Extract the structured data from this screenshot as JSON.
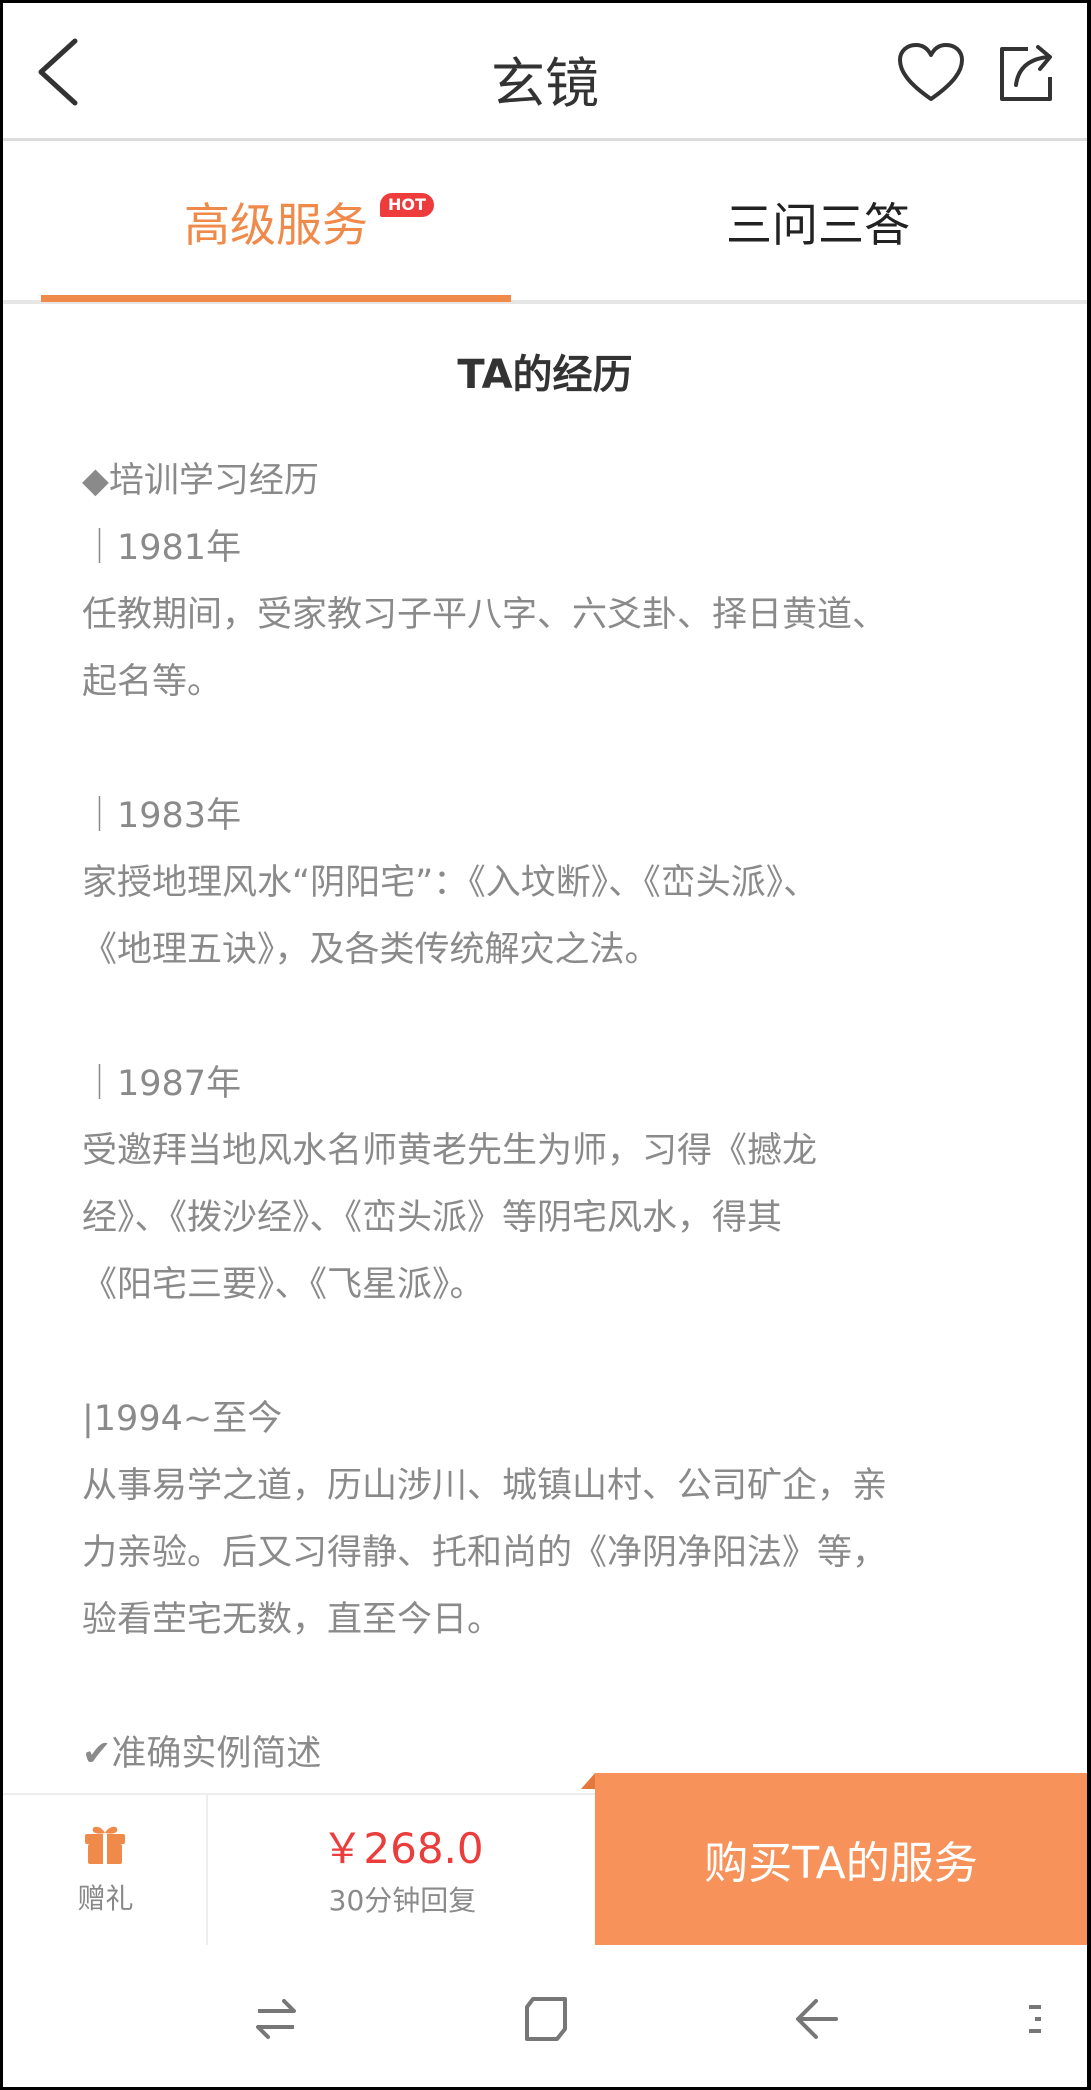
{
  "header": {
    "title": "玄镜"
  },
  "tabs": {
    "advanced_label": "高级服务",
    "hot_badge": "HOT",
    "qa_label": "三问三答"
  },
  "content": {
    "section_title": "TA的经历",
    "lines": [
      "◆培训学习经历",
      "｜1981年",
      "任教期间，受家教习子平八字、六爻卦、择日黄道、",
      "起名等。",
      "",
      "｜1983年",
      "家授地理风水“阴阳宅”：《入坟断》、《峦头派》、",
      "《地理五诀》，及各类传统解灾之法。",
      "",
      "｜1987年",
      "受邀拜当地风水名师黄老先生为师，习得《撼龙",
      "经》、《拨沙经》、《峦头派》等阴宅风水，得其",
      "《阳宅三要》、《飞星派》。",
      "",
      "|1994~至今",
      "从事易学之道，历山涉川、城镇山村、公司矿企，亲",
      "力亲验。后又习得静、托和尚的《净阴净阳法》等，",
      "验看茔宅无数，直至今日。",
      "",
      "✔准确实例简述"
    ]
  },
  "buybar": {
    "gift_label": "赠礼",
    "price": "￥268.0",
    "reply_time": "30分钟回复",
    "buy_label": "购买TA的服务"
  },
  "colors": {
    "accent": "#f08a4b",
    "buy_button": "#f7925a",
    "price": "#ec3d3d",
    "hot_badge": "#ee3b3b"
  },
  "icons": {
    "back": "chevron-left-icon",
    "favorite": "heart-icon",
    "share": "share-icon",
    "gift": "gift-icon",
    "nav_switch": "switch-arrows-icon",
    "nav_home": "square-home-icon",
    "nav_back": "back-arrow-icon",
    "nav_menu": "menu-dots-icon"
  }
}
